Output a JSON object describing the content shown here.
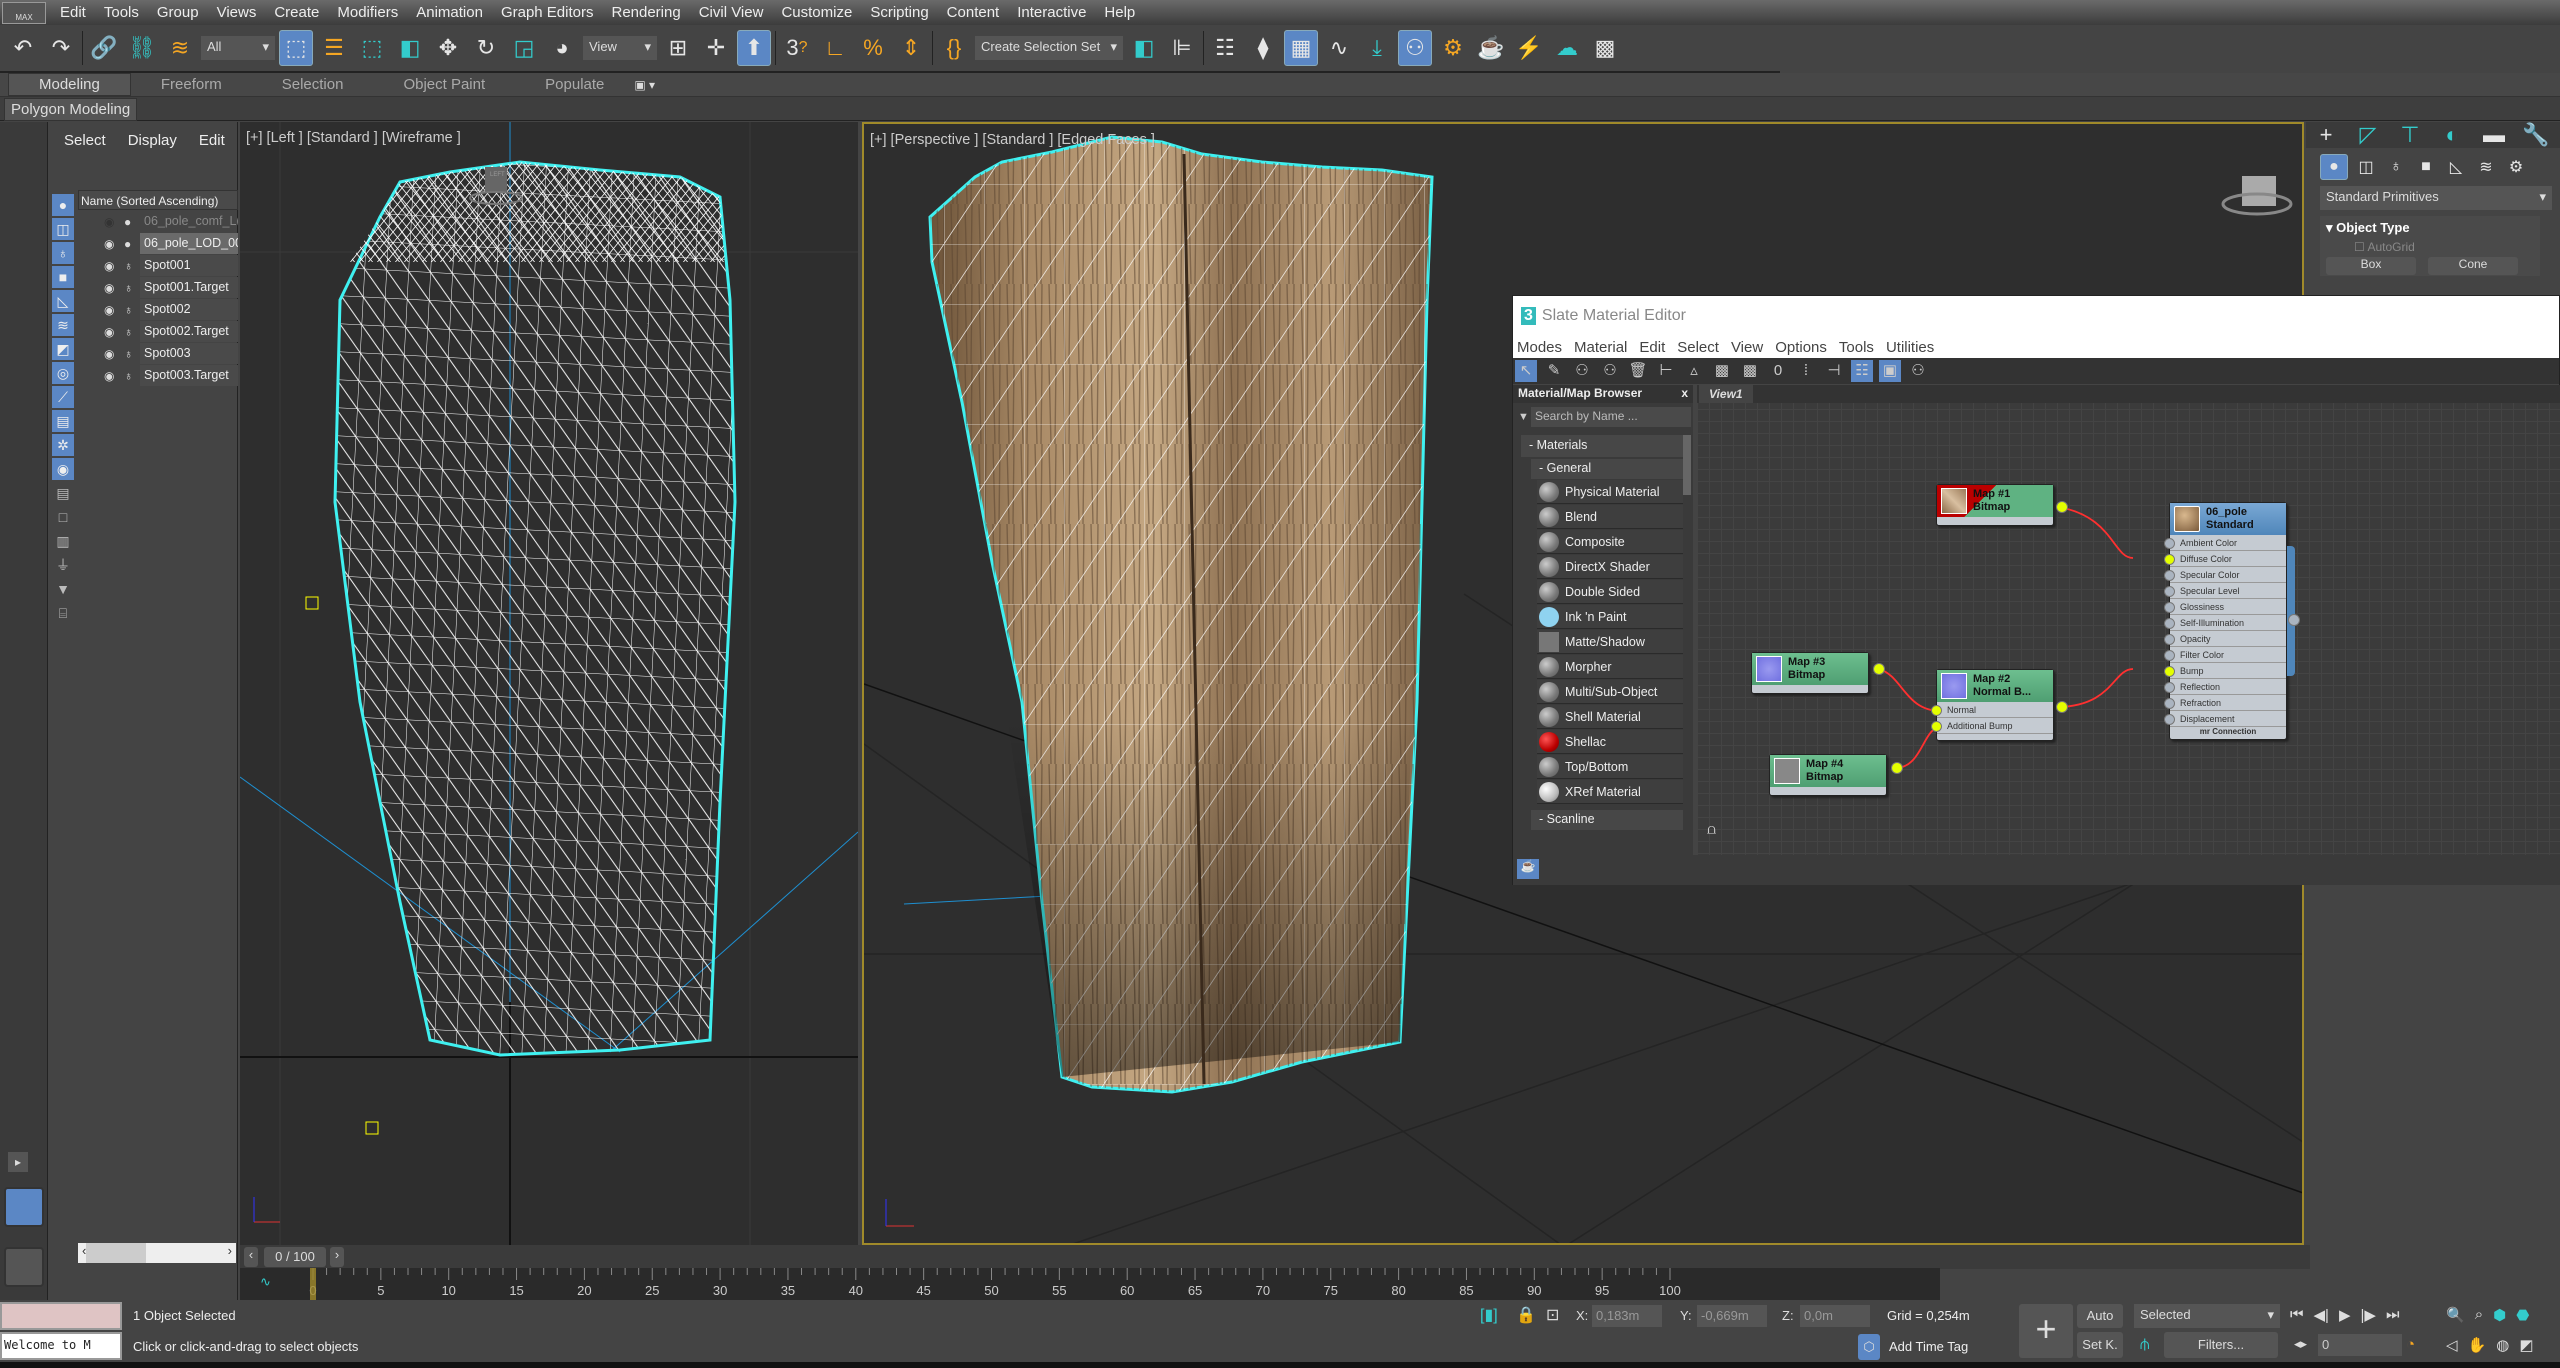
{
  "app": {
    "logo": "MAX"
  },
  "menu": [
    "Edit",
    "Tools",
    "Group",
    "Views",
    "Create",
    "Modifiers",
    "Animation",
    "Graph Editors",
    "Rendering",
    "Civil View",
    "Customize",
    "Scripting",
    "Content",
    "Interactive",
    "Help"
  ],
  "toolbar": {
    "selection_filter": "All",
    "ref_coord": "View",
    "named_selection": "Create Selection Set",
    "snap_label": "3"
  },
  "ribbon": {
    "tabs": [
      "Modeling",
      "Freeform",
      "Selection",
      "Object Paint",
      "Populate"
    ],
    "active_tab": "Modeling",
    "panel": "Polygon Modeling"
  },
  "explorer": {
    "menu": [
      "Select",
      "Display",
      "Edit"
    ],
    "column_header": "Name (Sorted Ascending)",
    "rows": [
      {
        "name": "06_pole_comf_L(",
        "hidden": true
      },
      {
        "name": "06_pole_LOD_00",
        "selected": true
      },
      {
        "name": "Spot001"
      },
      {
        "name": "Spot001.Target"
      },
      {
        "name": "Spot002"
      },
      {
        "name": "Spot002.Target"
      },
      {
        "name": "Spot003"
      },
      {
        "name": "Spot003.Target"
      }
    ]
  },
  "viewports": {
    "left_label": "[+] [Left ] [Standard ] [Wireframe ]",
    "persp_label": "[+] [Perspective ] [Standard ] [Edged Faces ]",
    "viewcube_left": "LEFT"
  },
  "command_panel": {
    "dropdown": "Standard Primitives",
    "rollout": "Object Type",
    "autogrid": "AutoGrid",
    "buttons": [
      "Box",
      "Cone"
    ]
  },
  "slate": {
    "title": "Slate Material Editor",
    "menu": [
      "Modes",
      "Material",
      "Edit",
      "Select",
      "View",
      "Options",
      "Tools",
      "Utilities"
    ],
    "browser": {
      "title": "Material/Map Browser",
      "close": "x",
      "search_placeholder": "Search by Name ...",
      "group": "Materials",
      "subgroup": "General",
      "items": [
        "Physical Material",
        "Blend",
        "Composite",
        "DirectX Shader",
        "Double Sided",
        "Ink 'n Paint",
        "Matte/Shadow",
        "Morpher",
        "Multi/Sub-Object",
        "Shell Material",
        "Shellac",
        "Top/Bottom",
        "XRef Material"
      ],
      "next_subgroup": "Scanline"
    },
    "view_tab": "View1",
    "nodes": {
      "map1": {
        "name": "Map #1",
        "type": "Bitmap"
      },
      "map2": {
        "name": "Map #2",
        "type": "Normal B...",
        "slots": [
          "Normal",
          "Additional Bump"
        ]
      },
      "map3": {
        "name": "Map #3",
        "type": "Bitmap"
      },
      "map4": {
        "name": "Map #4",
        "type": "Bitmap"
      },
      "material": {
        "name": "06_pole",
        "type": "Standard",
        "slots": [
          "Ambient Color",
          "Diffuse Color",
          "Specular Color",
          "Specular Level",
          "Glossiness",
          "Self-Illumination",
          "Opacity",
          "Filter Color",
          "Bump",
          "Reflection",
          "Refraction",
          "Displacement"
        ],
        "footer": "mr Connection"
      }
    }
  },
  "timeline": {
    "frame": "0 / 100",
    "start": 0,
    "end": 100,
    "current": 0,
    "label_step": 5
  },
  "status": {
    "selected": "1 Object Selected",
    "prompt": "Click or click-and-drag to select objects",
    "listener": "Welcome to M",
    "x_label": "X:",
    "x": "0,183m",
    "y_label": "Y:",
    "y": "-0,669m",
    "z_label": "Z:",
    "z": "0,0m",
    "grid": "Grid = 0,254m",
    "time_tag": "Add Time Tag",
    "auto": "Auto",
    "setkey": "Set K.",
    "key_filter": "Selected",
    "filters": "Filters...",
    "frame_field": "0"
  },
  "colors": {
    "accent": "#5b87c5",
    "selection": "#3ff0f0",
    "wire": "#ff3030",
    "socket_on": "#e4ff00",
    "node_green": "#5fb282",
    "viewport_border": "#a08a2a"
  }
}
